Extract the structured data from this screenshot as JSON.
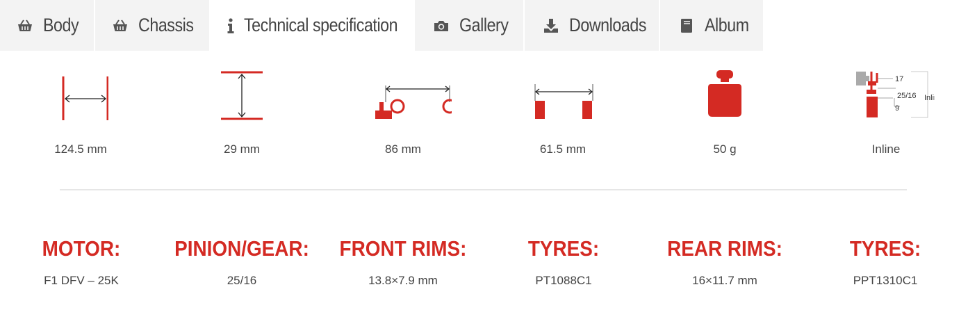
{
  "tabs": [
    {
      "label": "Body",
      "icon": "basket-icon"
    },
    {
      "label": "Chassis",
      "icon": "basket-icon"
    },
    {
      "label": "Technical specification",
      "icon": "info-icon"
    },
    {
      "label": "Gallery",
      "icon": "camera-icon"
    },
    {
      "label": "Downloads",
      "icon": "download-icon"
    },
    {
      "label": "Album",
      "icon": "book-icon"
    }
  ],
  "active_tab": "Technical specification",
  "specs": {
    "length": "124.5 mm",
    "height": "29 mm",
    "wheelbase": "86 mm",
    "track": "61.5 mm",
    "weight": "50 g",
    "configuration": "Inline"
  },
  "config_diagram": {
    "labels": [
      "17",
      "25/16",
      "9",
      "Inline"
    ]
  },
  "details": [
    {
      "heading": "MOTOR:",
      "value": "F1 DFV – 25K"
    },
    {
      "heading": "PINION/GEAR:",
      "value": "25/16"
    },
    {
      "heading": "FRONT RIMS:",
      "value": "13.8×7.9 mm"
    },
    {
      "heading": "TYRES:",
      "value": "PT1088C1"
    },
    {
      "heading": "REAR RIMS:",
      "value": "16×11.7 mm"
    },
    {
      "heading": "TYRES:",
      "value": "PPT1310C1"
    }
  ],
  "colors": {
    "accent": "#d42a23",
    "text": "#444444",
    "tab_bg": "#f3f3f3"
  }
}
